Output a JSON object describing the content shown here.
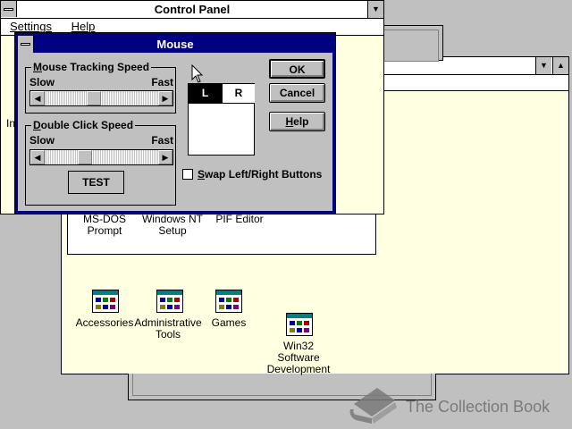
{
  "control_panel": {
    "title": "Control Panel",
    "menu": [
      "Settings",
      "Help"
    ],
    "partial_label": "In"
  },
  "program_manager_group": {
    "items": [
      "MS-DOS Prompt",
      "Windows NT Setup",
      "PIF Editor"
    ],
    "item_lines": [
      [
        "MS-DOS",
        "Prompt"
      ],
      [
        "Windows NT",
        "Setup"
      ],
      [
        "PIF Editor"
      ]
    ]
  },
  "program_groups": [
    {
      "lines": [
        "Accessories"
      ]
    },
    {
      "lines": [
        "Administrative",
        "Tools"
      ]
    },
    {
      "lines": [
        "Games"
      ]
    },
    {
      "lines": [
        "Win32",
        "Software",
        "Development"
      ]
    }
  ],
  "mouse_dialog": {
    "title": "Mouse",
    "tracking_speed": {
      "label_pre": "",
      "label_u": "M",
      "label_post": "ouse Tracking Speed",
      "slow": "Slow",
      "fast": "Fast",
      "position": 0.42
    },
    "double_click": {
      "label_pre": "",
      "label_u": "D",
      "label_post": "ouble Click Speed",
      "slow": "Slow",
      "fast": "Fast",
      "position": 0.33
    },
    "test_button": "TEST",
    "mouse_left": "L",
    "mouse_right": "R",
    "swap": {
      "label_u": "S",
      "label_post": "wap Left/Right Buttons",
      "checked": false
    },
    "ok": "OK",
    "cancel": "Cancel",
    "help_u": "H",
    "help_post": "elp"
  },
  "watermark": {
    "text": "The Collection Book"
  },
  "colors": {
    "title_active": "#000080",
    "desktop": "#c0c0c0",
    "workspace": "#ffffe1"
  }
}
